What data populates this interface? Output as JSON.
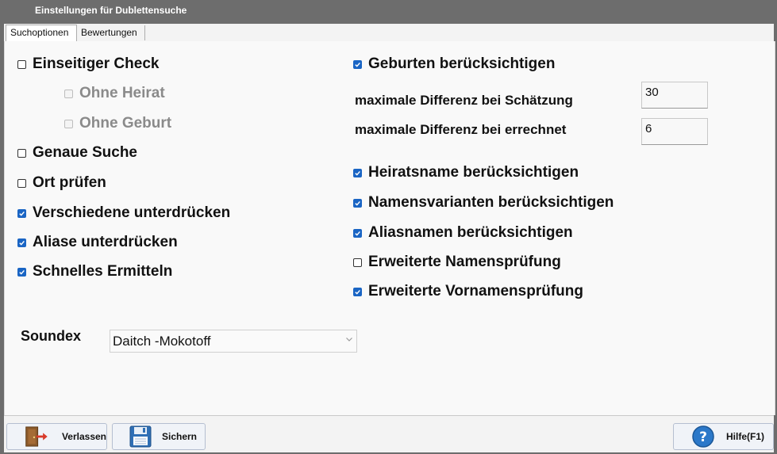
{
  "window": {
    "title": "Einstellungen für Dublettensuche"
  },
  "tabs": [
    {
      "label": "Suchoptionen",
      "active": true
    },
    {
      "label": "Bewertungen",
      "active": false
    }
  ],
  "left_options": [
    {
      "label": "Einseitiger Check",
      "checked": false,
      "enabled": true
    },
    {
      "label": "Ohne Heirat",
      "checked": false,
      "enabled": false
    },
    {
      "label": "Ohne Geburt",
      "checked": false,
      "enabled": false
    },
    {
      "label": "Genaue Suche",
      "checked": false,
      "enabled": true
    },
    {
      "label": "Ort prüfen",
      "checked": false,
      "enabled": true
    },
    {
      "label": "Verschiedene unterdrücken",
      "checked": true,
      "enabled": true
    },
    {
      "label": "Aliase unterdrücken",
      "checked": true,
      "enabled": true
    },
    {
      "label": "Schnelles Ermitteln",
      "checked": true,
      "enabled": true
    }
  ],
  "right_options": {
    "births": {
      "label": "Geburten berücksichtigen",
      "checked": true
    },
    "max_diff_estimate": {
      "label": "maximale Differenz bei Schätzung",
      "value": "30"
    },
    "max_diff_calculated": {
      "label": "maximale Differenz bei errechnet",
      "value": "6"
    },
    "items": [
      {
        "label": "Heiratsname berücksichtigen",
        "checked": true
      },
      {
        "label": "Namensvarianten berücksichtigen",
        "checked": true
      },
      {
        "label": "Aliasnamen berücksichtigen",
        "checked": true
      },
      {
        "label": "Erweiterte Namensprüfung",
        "checked": false
      },
      {
        "label": "Erweiterte Vornamensprüfung",
        "checked": true
      }
    ]
  },
  "soundex": {
    "label": "Soundex",
    "selected": "Daitch -Mokotoff"
  },
  "buttons": {
    "leave": "Verlassen",
    "save": "Sichern",
    "help": "Hilfe(F1)"
  },
  "colors": {
    "checkbox_checked": "#1a65c4",
    "titlebar": "#6d6d6d",
    "panel": "#f9f9f9"
  }
}
